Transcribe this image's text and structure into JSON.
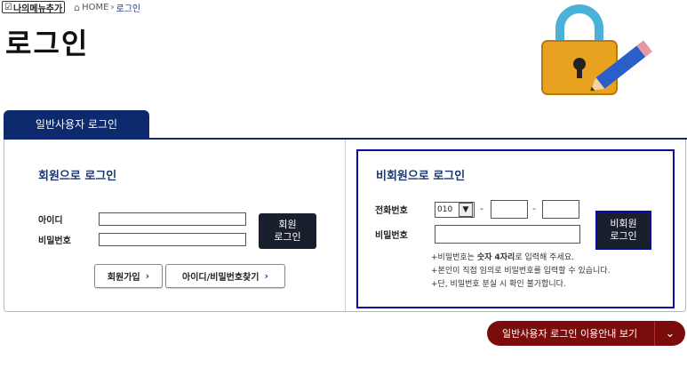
{
  "topbar": {
    "my_menu_label": "나의메뉴추가",
    "home": "HOME",
    "current": "로그인"
  },
  "page_title": "로그인",
  "tab_label": "일반사용자 로그인",
  "member": {
    "title": "회원으로 로그인",
    "id_label": "아이디",
    "pw_label": "비밀번호",
    "login_button_line1": "회원",
    "login_button_line2": "로그인",
    "signup_label": "회원가입",
    "find_label": "아이디/비밀번호찾기"
  },
  "nonmember": {
    "title": "비회원으로 로그인",
    "phone_label": "전화번호",
    "phone_prefix": "010",
    "pw_label": "비밀번호",
    "login_button_line1": "비회원",
    "login_button_line2": "로그인",
    "note1_pre": "비밀번호는 ",
    "note1_bold": "숫자 4자리",
    "note1_post": "로 입력해 주세요.",
    "note2": "본인이 직접 임의로 비밀번호를 입력할 수 있습니다.",
    "note3": "단, 비밀번호 분실 시 확인 불가합니다."
  },
  "guide_label": "일반사용자 로그인 이용안내 보기",
  "colors": {
    "navy": "#0d2a6e",
    "dark_button": "#1a1f2e",
    "border_blue": "#0a0aa8",
    "guide_red": "#7a0c0c"
  }
}
